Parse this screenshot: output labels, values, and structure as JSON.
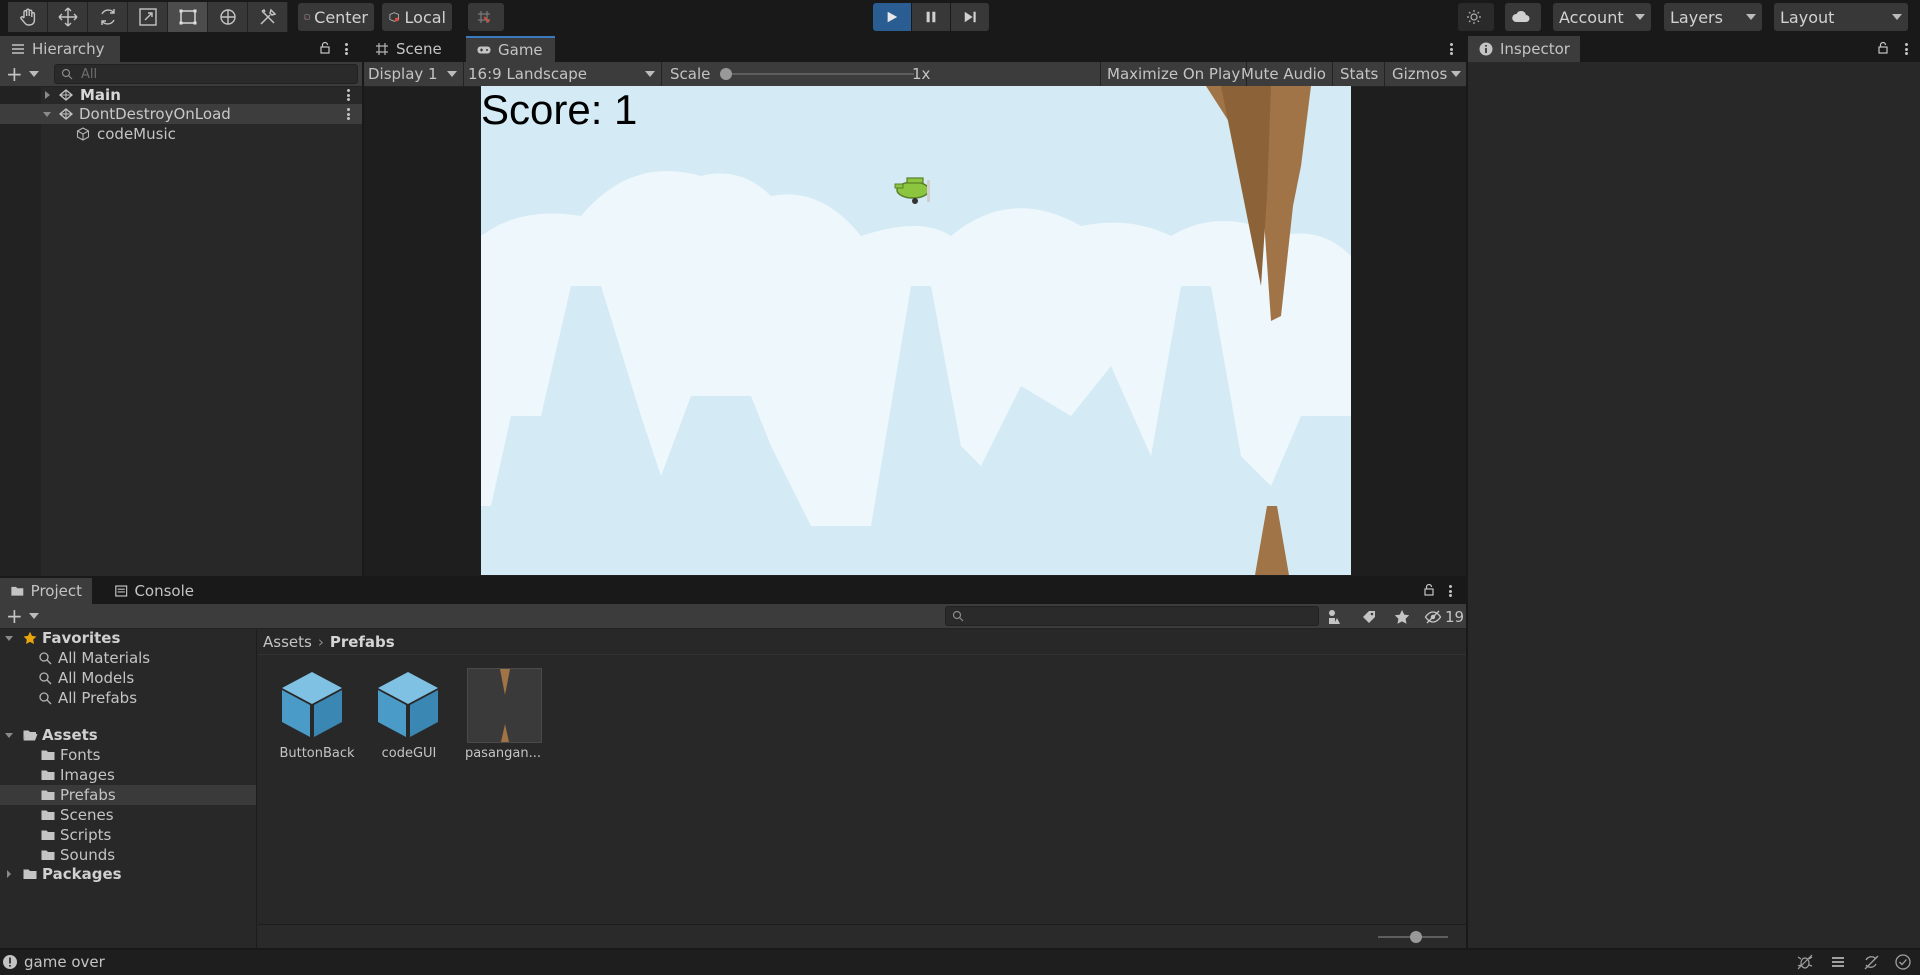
{
  "toolbar": {
    "center_label": "Center",
    "local_label": "Local",
    "account_label": "Account",
    "layers_label": "Layers",
    "layout_label": "Layout"
  },
  "hierarchy": {
    "tab_label": "Hierarchy",
    "search_placeholder": "All",
    "items": [
      {
        "label": "Main"
      },
      {
        "label": "DontDestroyOnLoad"
      },
      {
        "label": "codeMusic"
      }
    ]
  },
  "scene_tabs": {
    "scene_label": "Scene",
    "game_label": "Game"
  },
  "game_toolbar": {
    "display": "Display 1",
    "aspect": "16:9 Landscape",
    "scale_label": "Scale",
    "scale_value": "1x",
    "maximize": "Maximize On Play",
    "mute": "Mute Audio",
    "stats": "Stats",
    "gizmos": "Gizmos"
  },
  "game": {
    "score_text": "Score: 1"
  },
  "inspector": {
    "tab_label": "Inspector"
  },
  "project": {
    "project_tab": "Project",
    "console_tab": "Console",
    "hidden_count": "19",
    "breadcrumb": [
      "Assets",
      "Prefabs"
    ],
    "favorites_label": "Favorites",
    "favorites": [
      "All Materials",
      "All Models",
      "All Prefabs"
    ],
    "assets_label": "Assets",
    "folders": [
      "Fonts",
      "Images",
      "Prefabs",
      "Scenes",
      "Scripts",
      "Sounds"
    ],
    "packages_label": "Packages",
    "assets": [
      {
        "label": "ButtonBack",
        "icon": "prefab-icon"
      },
      {
        "label": "codeGUI",
        "icon": "prefab-icon"
      },
      {
        "label": "pasangan...",
        "icon": "thumbnail"
      }
    ]
  },
  "status": {
    "message": "game over"
  },
  "colors": {
    "accent": "#2a5d91",
    "selection": "#2c5d87",
    "sky": "#d4ebf5"
  }
}
